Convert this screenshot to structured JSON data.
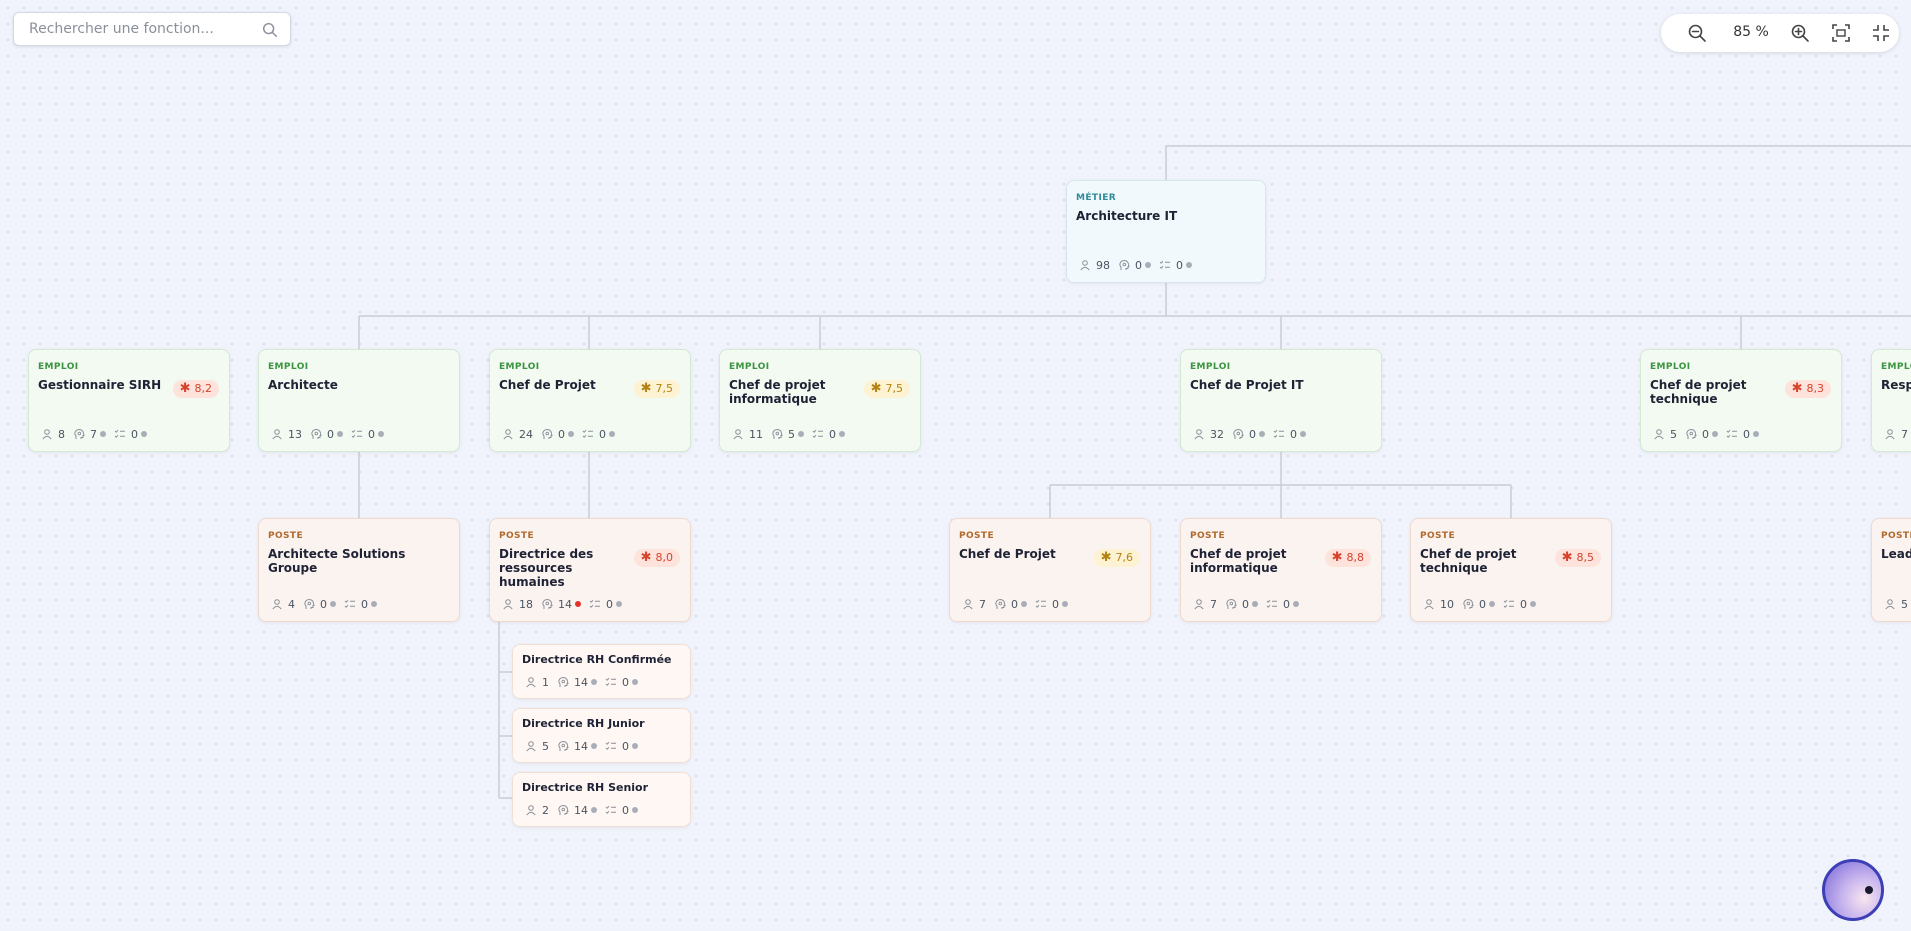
{
  "search": {
    "placeholder": "Rechercher une fonction..."
  },
  "zoom": {
    "level": "85 %"
  },
  "icons": {
    "people": "person-icon",
    "skills": "head-icon",
    "tasks": "checklist-icon",
    "search": "search-icon"
  },
  "colors": {
    "metier_label": "#2f8c99",
    "emploi_label": "#3a9440",
    "poste_label": "#b06a2c",
    "score_high": "#d7432d",
    "score_mid": "#b38212",
    "alert_dot": "#e0352b"
  },
  "nodes": {
    "metier": {
      "type": "MÉTIER",
      "title": "Architecture IT",
      "people": "98",
      "skills": "0",
      "tasks": "0"
    },
    "emplois": [
      {
        "type": "EMPLOI",
        "title": "Gestionnaire SIRH",
        "score": "8,2",
        "people": "8",
        "skills": "7",
        "tasks": "0"
      },
      {
        "type": "EMPLOI",
        "title": "Architecte",
        "people": "13",
        "skills": "0",
        "tasks": "0"
      },
      {
        "type": "EMPLOI",
        "title": "Chef de Projet",
        "score": "7,5",
        "people": "24",
        "skills": "0",
        "tasks": "0"
      },
      {
        "type": "EMPLOI",
        "title": "Chef de projet informatique",
        "score": "7,5",
        "people": "11",
        "skills": "5",
        "tasks": "0"
      },
      {
        "type": "EMPLOI",
        "title": "Chef de Projet IT",
        "people": "32",
        "skills": "0",
        "tasks": "0"
      },
      {
        "type": "EMPLOI",
        "title": "Chef de projet technique",
        "score": "8,3",
        "people": "5",
        "skills": "0",
        "tasks": "0"
      },
      {
        "type": "EMPLOI",
        "title": "Resp",
        "people": "7"
      }
    ],
    "postes": [
      {
        "type": "POSTE",
        "title": "Architecte Solutions Groupe",
        "people": "4",
        "skills": "0",
        "tasks": "0"
      },
      {
        "type": "POSTE",
        "title": "Directrice des ressources humaines",
        "score": "8,0",
        "people": "18",
        "skills": "14",
        "tasks": "0"
      },
      {
        "type": "POSTE",
        "title": "Chef de Projet",
        "score": "7,6",
        "people": "7",
        "skills": "0",
        "tasks": "0"
      },
      {
        "type": "POSTE",
        "title": "Chef de projet informatique",
        "score": "8,8",
        "people": "7",
        "skills": "0",
        "tasks": "0"
      },
      {
        "type": "POSTE",
        "title": "Chef de projet technique",
        "score": "8,5",
        "people": "10",
        "skills": "0",
        "tasks": "0"
      },
      {
        "type": "POSTE",
        "title": "Lead",
        "people": "5"
      }
    ],
    "sub_postes": [
      {
        "title": "Directrice RH Confirmée",
        "people": "1",
        "skills": "14",
        "tasks": "0"
      },
      {
        "title": "Directrice RH Junior",
        "people": "5",
        "skills": "14",
        "tasks": "0"
      },
      {
        "title": "Directrice RH Senior",
        "people": "2",
        "skills": "14",
        "tasks": "0"
      }
    ]
  }
}
